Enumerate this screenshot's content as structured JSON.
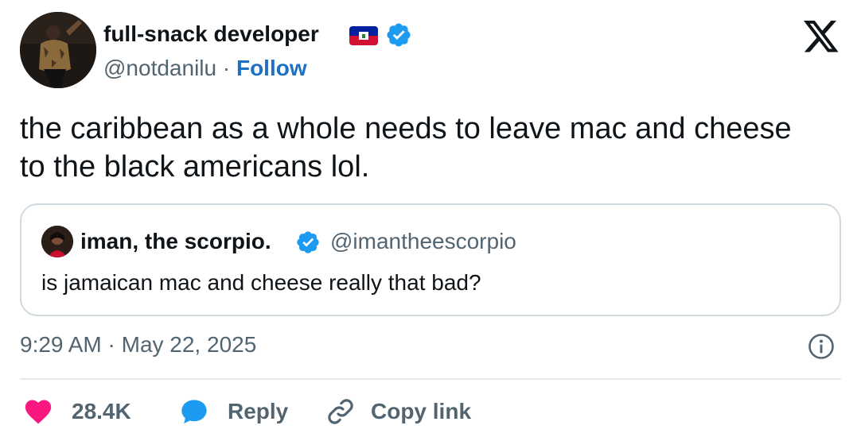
{
  "author": {
    "name": "full-snack developer",
    "handle": "@notdanilu",
    "separator": "·",
    "follow_label": "Follow",
    "flag_icon": "haiti-flag-icon",
    "verified_icon": "verified-badge-icon"
  },
  "brand": {
    "logo": "x-logo-icon"
  },
  "tweet": {
    "text": "the caribbean as a whole needs to leave mac and cheese to the black americans lol."
  },
  "quote": {
    "name": "iman, the scorpio.",
    "handle": "@imantheescorpio",
    "text": "is jamaican mac and cheese really that bad?"
  },
  "meta": {
    "timestamp": "9:29 AM · May 22, 2025",
    "info_icon": "info-icon"
  },
  "actions": {
    "like_count": "28.4K",
    "reply_label": "Reply",
    "copy_label": "Copy link"
  },
  "colors": {
    "like": "#f91880",
    "reply": "#1d9bf0",
    "link": "#1d70c4",
    "verified": "#1d9bf0",
    "muted": "#536471",
    "border": "#cfd9de"
  }
}
